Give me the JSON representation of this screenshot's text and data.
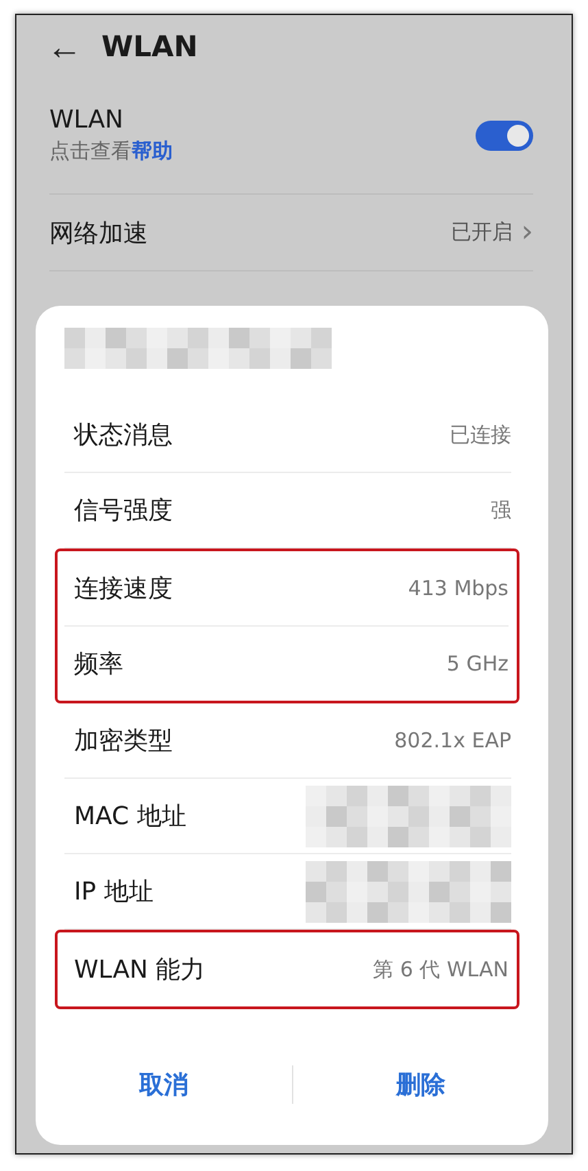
{
  "header": {
    "back": "←",
    "title": "WLAN"
  },
  "settings": [
    {
      "kind": "switch",
      "label": "WLAN",
      "subtitle": "点击查看**帮助**",
      "on": true
    },
    {
      "kind": "link",
      "label": "网络加速",
      "value": "已开启",
      "chevron": "›"
    }
  ],
  "dialog": {
    "title": {
      "kind": "redacted"
    },
    "rows": [
      {
        "label": "状态消息",
        "kind": "text",
        "value": "已连接",
        "highlighted": false
      },
      {
        "label": "信号强度",
        "kind": "text",
        "value": "强",
        "highlighted": false
      },
      {
        "label": "连接速度",
        "kind": "text",
        "value": "413 Mbps",
        "highlighted": true
      },
      {
        "label": "频率",
        "kind": "text",
        "value": "5 GHz",
        "highlighted": true
      },
      {
        "label": "加密类型",
        "kind": "text",
        "value": "802.1x EAP",
        "highlighted": false
      },
      {
        "label": "MAC 地址",
        "kind": "redacted",
        "highlighted": false
      },
      {
        "label": "IP 地址",
        "kind": "redacted",
        "highlighted": false
      },
      {
        "label": "WLAN 能力",
        "kind": "text",
        "value": "第 6 代 WLAN",
        "highlighted": true
      }
    ],
    "buttons": [
      "取消",
      "删除"
    ]
  }
}
